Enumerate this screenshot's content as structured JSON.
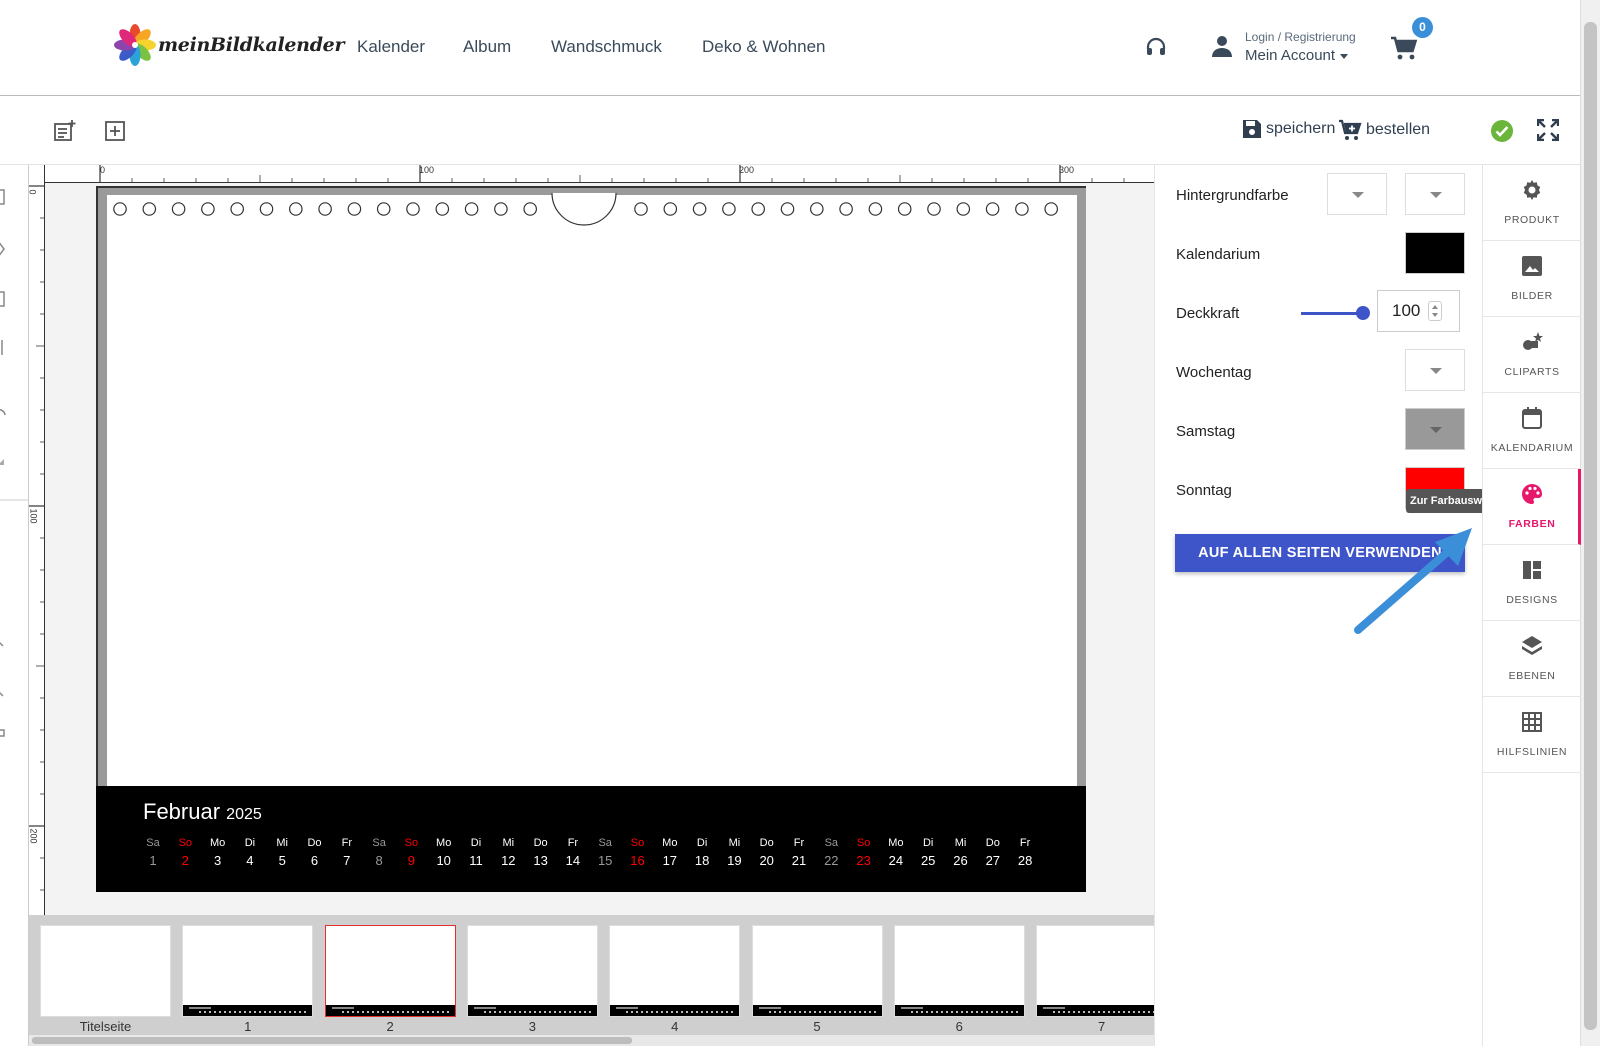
{
  "brand": {
    "name": "meinBildkalender"
  },
  "nav": {
    "items": [
      "Kalender",
      "Album",
      "Wandschmuck",
      "Deko & Wohnen"
    ]
  },
  "account": {
    "small": "Login / Registrierung",
    "main": "Mein Account"
  },
  "cart": {
    "count": "0"
  },
  "toolbar": {
    "save_label": "speichern",
    "order_label": "bestellen"
  },
  "ruler": {
    "top_labels": [
      "0",
      "100",
      "200",
      "300"
    ],
    "left_labels": [
      "0",
      "100",
      "200"
    ]
  },
  "calendar": {
    "month": "Februar",
    "year": "2025",
    "weekdays": [
      "Sa",
      "So",
      "Mo",
      "Di",
      "Mi",
      "Do",
      "Fr",
      "Sa",
      "So",
      "Mo",
      "Di",
      "Mi",
      "Do",
      "Fr",
      "Sa",
      "So",
      "Mo",
      "Di",
      "Mi",
      "Do",
      "Fr",
      "Sa",
      "So",
      "Mo",
      "Di",
      "Mi",
      "Do",
      "Fr"
    ],
    "days": [
      "1",
      "2",
      "3",
      "4",
      "5",
      "6",
      "7",
      "8",
      "9",
      "10",
      "11",
      "12",
      "13",
      "14",
      "15",
      "16",
      "17",
      "18",
      "19",
      "20",
      "21",
      "22",
      "23",
      "24",
      "25",
      "26",
      "27",
      "28"
    ],
    "colors": {
      "weekday": "#ffffff",
      "saturday": "#999999",
      "sunday": "#ff0000"
    }
  },
  "filmstrip": {
    "labels": [
      "Titelseite",
      "1",
      "2",
      "3",
      "4",
      "5",
      "6",
      "7"
    ],
    "active_index": 2
  },
  "panel": {
    "hintergrundfarbe": "Hintergrundfarbe",
    "kalendarium": "Kalendarium",
    "deckkraft": "Deckkraft",
    "deckkraft_value": "100",
    "wochentag": "Wochentag",
    "samstag": "Samstag",
    "sonntag": "Sonntag",
    "apply_button": "AUF ALLEN SEITEN VERWENDEN",
    "swatch_colors": {
      "kalendarium": "#000000",
      "samstag": "#999999",
      "sonntag": "#ff0000"
    }
  },
  "tooltip": "Zur Farbauswahl",
  "sidebar": {
    "items": [
      {
        "label": "PRODUKT",
        "icon": "gear-icon"
      },
      {
        "label": "BILDER",
        "icon": "image-icon"
      },
      {
        "label": "CLIPARTS",
        "icon": "cliparts-icon"
      },
      {
        "label": "KALENDARIUM",
        "icon": "calendar-icon"
      },
      {
        "label": "FARBEN",
        "icon": "palette-icon"
      },
      {
        "label": "DESIGNS",
        "icon": "designs-icon"
      },
      {
        "label": "EBENEN",
        "icon": "layers-icon"
      },
      {
        "label": "HILFSLINIEN",
        "icon": "grid-icon"
      }
    ],
    "active_index": 4,
    "accent": "#e6186b"
  },
  "colors": {
    "primary": "#3d55c9",
    "badge": "#3b8fd9",
    "check": "#6bb53a"
  }
}
